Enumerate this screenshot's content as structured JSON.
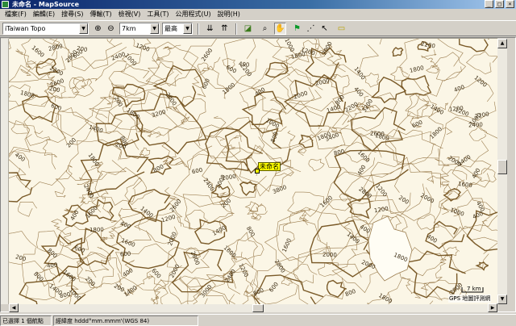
{
  "window": {
    "title": "未命名 - MapSource"
  },
  "menu": [
    "檔案(F)",
    "編輯(E)",
    "搜尋(S)",
    "傳輸(T)",
    "檢視(V)",
    "工具(T)",
    "公用程式(U)",
    "說明(H)"
  ],
  "toolbar": {
    "product": "iTaiwan Topo",
    "zoom": "7km",
    "detail": "最高",
    "icons": [
      {
        "name": "zoom-in-icon",
        "glyph": "⊕"
      },
      {
        "name": "zoom-out-icon",
        "glyph": "⊖"
      },
      {
        "name": "receive-from-device-icon",
        "glyph": "⇊"
      },
      {
        "name": "send-to-device-icon",
        "glyph": "⇈"
      },
      {
        "name": "map-select-tool-icon",
        "glyph": "◪"
      },
      {
        "name": "zoom-tool-icon",
        "glyph": "⌕"
      },
      {
        "name": "hand-tool-icon",
        "glyph": "✋"
      },
      {
        "name": "waypoint-tool-icon",
        "glyph": "⚑"
      },
      {
        "name": "route-tool-icon",
        "glyph": "⋰"
      },
      {
        "name": "pointer-tool-icon",
        "glyph": "↖"
      },
      {
        "name": "distance-tool-icon",
        "glyph": "▭"
      }
    ]
  },
  "map": {
    "waypoint": "未命名",
    "contour_labels": [
      "200",
      "600",
      "1200",
      "1000",
      "1400",
      "1000",
      "1600",
      "2000",
      "1600",
      "2400",
      "2000",
      "800",
      "400",
      "2800",
      "200",
      "1400",
      "1800",
      "2400",
      "800",
      "1000",
      "1200",
      "1400",
      "400",
      "2400",
      "200",
      "1800",
      "2000",
      "1200",
      "2000",
      "2000",
      "400",
      "2200",
      "1200",
      "2400",
      "1800",
      "1600",
      "1200",
      "2000",
      "2800",
      "400",
      "1800",
      "600",
      "2800",
      "1800",
      "2200",
      "400",
      "2600",
      "2000",
      "1600",
      "600",
      "2800",
      "2000",
      "1200",
      "2200",
      "1400",
      "1600",
      "1600",
      "400",
      "3800",
      "3200",
      "1200",
      "1200",
      "3400",
      "1600",
      "800",
      "400",
      "2800",
      "600",
      "800",
      "3000",
      "1800",
      "2000",
      "2400",
      "1800",
      "1000",
      "400",
      "2600",
      "1400",
      "400",
      "1400",
      "800",
      "2200",
      "400",
      "800",
      "1400",
      "200",
      "1800",
      "2600",
      "1800",
      "1000",
      "2200",
      "200",
      "400",
      "400",
      "800",
      "600",
      "400",
      "600",
      "200",
      "400",
      "200",
      "1600",
      "2600",
      "800",
      "2000",
      "1800",
      "1000",
      "3200",
      "1600",
      "1400",
      "1800",
      "1400",
      "1000",
      "800",
      "2000",
      "800",
      "600",
      "400",
      "1400",
      "1200",
      "600",
      "200",
      "600",
      "200",
      "2000",
      "1800",
      "600",
      "800",
      "200"
    ],
    "scale": "7 km",
    "copyright": "GPS 地圖評測網"
  },
  "status": {
    "selection": "已選擇 1 個航點",
    "coord_format": "經緯度 hddd°mm.mmm'(WGS 84)"
  },
  "colors": {
    "paper": "#fbf6e6",
    "contour": "#9c7e50",
    "index": "#7a5a28"
  }
}
